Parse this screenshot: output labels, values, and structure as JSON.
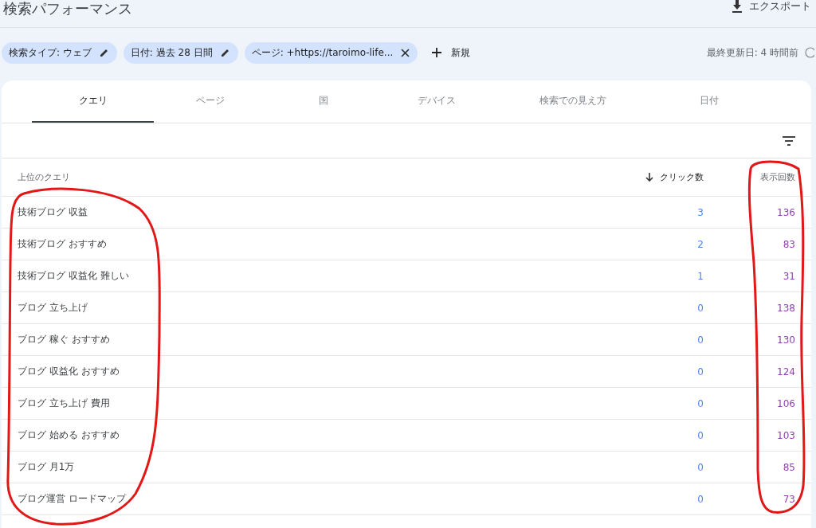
{
  "header": {
    "title": "検索パフォーマンス",
    "export_label": "エクスポート"
  },
  "filters": [
    {
      "label": "検索タイプ: ウェブ",
      "kind": "edit"
    },
    {
      "label": "日付: 過去 28 日間",
      "kind": "edit"
    },
    {
      "label": "ページ: +https://taroimo-life...",
      "kind": "remove"
    }
  ],
  "add_filter": {
    "label": "新規"
  },
  "last_updated": "最終更新日: 4 時間前",
  "tabs": [
    {
      "label": "クエリ",
      "selected": true
    },
    {
      "label": "ページ",
      "selected": false
    },
    {
      "label": "国",
      "selected": false
    },
    {
      "label": "デバイス",
      "selected": false
    },
    {
      "label": "検索での見え方",
      "selected": false
    },
    {
      "label": "日付",
      "selected": false
    }
  ],
  "table": {
    "columns": [
      {
        "label": "上位のクエリ",
        "sorted": false
      },
      {
        "label": "クリック数",
        "sorted": true
      },
      {
        "label": "表示回数",
        "sorted": false
      }
    ],
    "rows": [
      [
        "技術ブログ 収益",
        "3",
        "136"
      ],
      [
        "技術ブログ おすすめ",
        "2",
        "83"
      ],
      [
        "技術ブログ 収益化 難しい",
        "1",
        "31"
      ],
      [
        "ブログ 立ち上げ",
        "0",
        "138"
      ],
      [
        "ブログ 稼ぐ おすすめ",
        "0",
        "130"
      ],
      [
        "ブログ 収益化 おすすめ",
        "0",
        "124"
      ],
      [
        "ブログ 立ち上げ 費用",
        "0",
        "106"
      ],
      [
        "ブログ 始める おすすめ",
        "0",
        "103"
      ],
      [
        "ブログ 月1万",
        "0",
        "85"
      ],
      [
        "ブログ運営 ロードマップ",
        "0",
        "73"
      ]
    ]
  }
}
